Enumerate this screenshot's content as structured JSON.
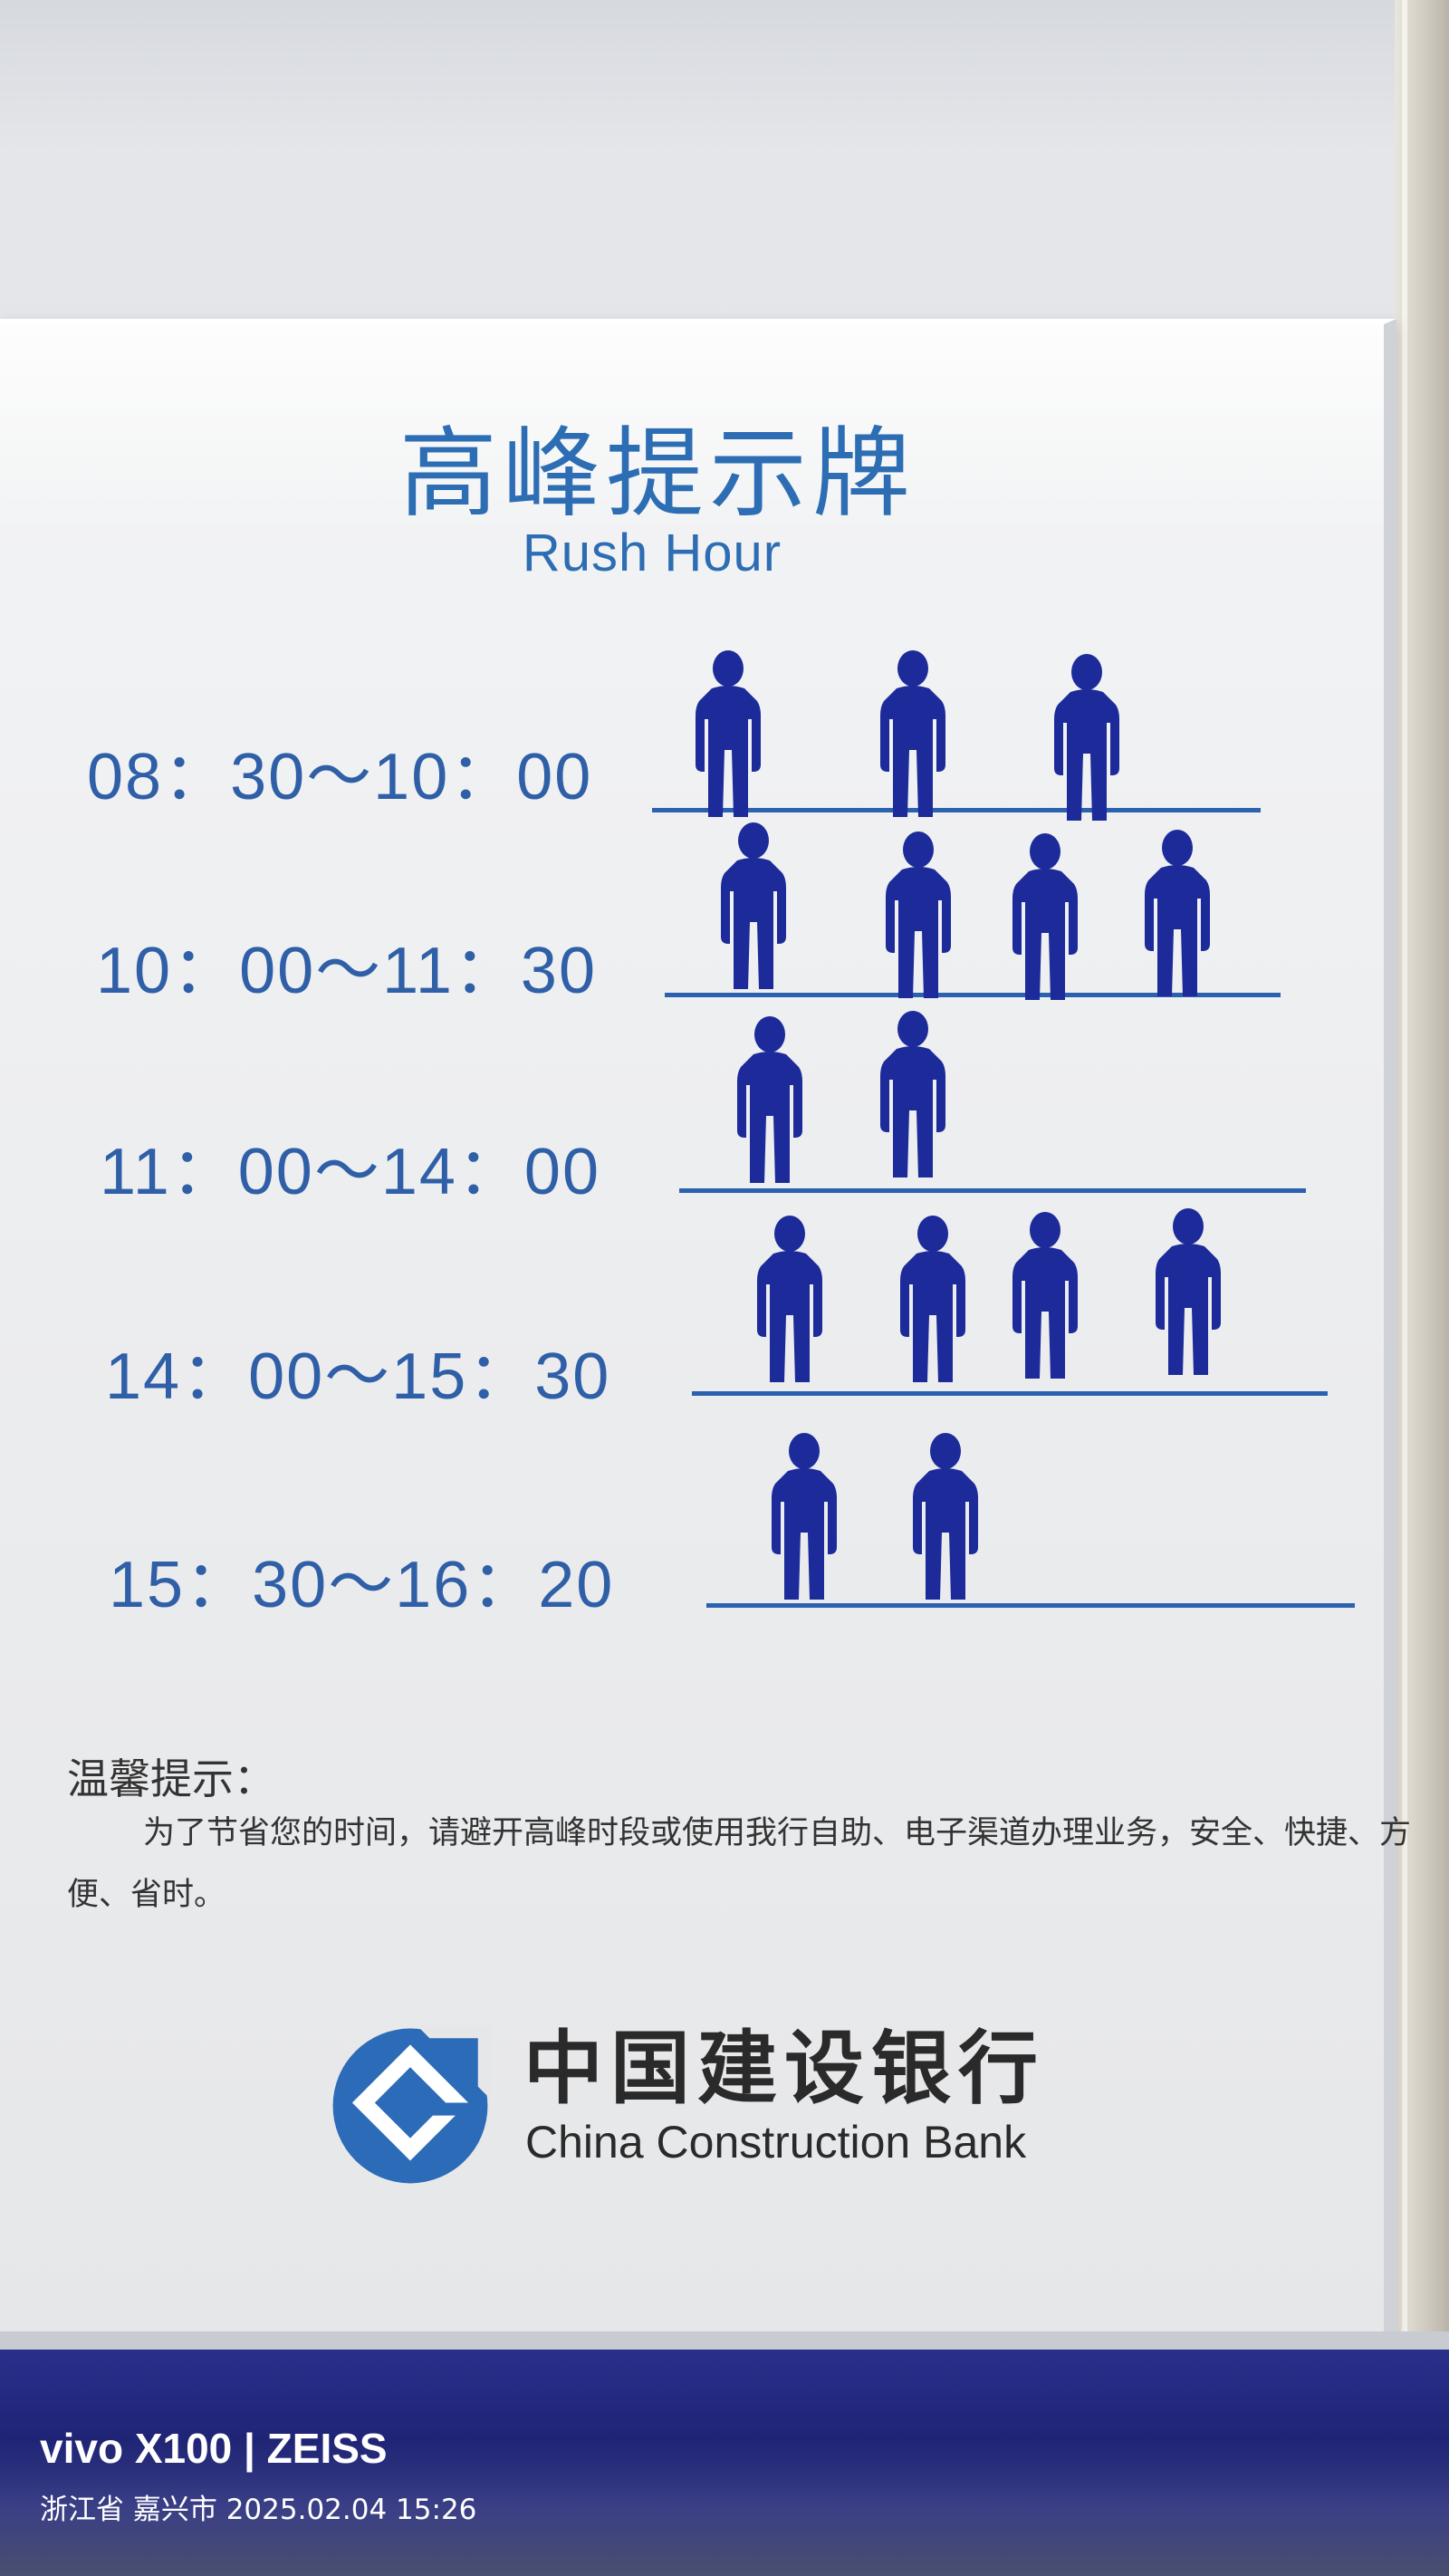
{
  "sign": {
    "title_cn": "高峰提示牌",
    "title_en": "Rush Hour",
    "rows": [
      {
        "time": "08：30～10：00",
        "people": 3
      },
      {
        "time": "10：00～11：30",
        "people": 4
      },
      {
        "time": "11：00～14：00",
        "people": 2
      },
      {
        "time": "14：00～15：30",
        "people": 4
      },
      {
        "time": "15：30～16：20",
        "people": 2
      }
    ],
    "tip_title": "温馨提示：",
    "tip_text": "为了节省您的时间，请避开高峰时段或使用我行自助、电子渠道办理业务，安全、快捷、方便、省时。",
    "bank_cn": "中国建设银行",
    "bank_en": "China Construction Bank"
  },
  "watermark": {
    "brand": "vivo X100 | ZEISS",
    "meta": "浙江省 嘉兴市  2025.02.04 15:26"
  },
  "colors": {
    "sign_blue": "#2d6db4",
    "figure_navy": "#1c2a9a",
    "strip_blue": "#2a2f8c"
  }
}
